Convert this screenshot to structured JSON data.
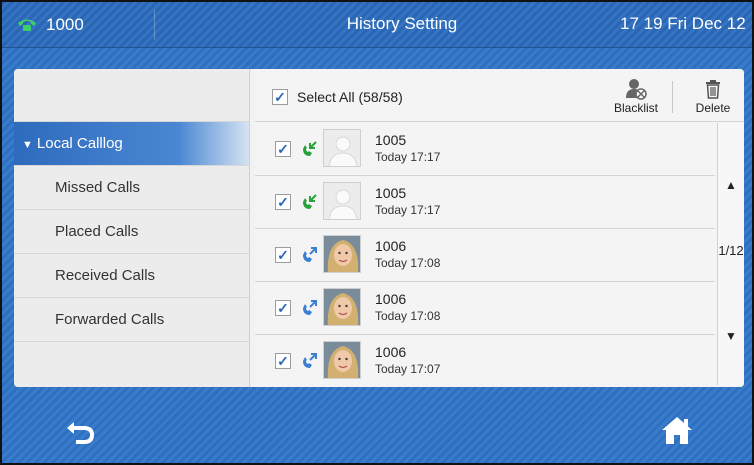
{
  "status_bar": {
    "account": "1000",
    "title": "History Setting",
    "clock": "17 19 Fri Dec 12",
    "account_icon": "phone-icon"
  },
  "sidebar": {
    "items": [
      {
        "label": "Local Calllog",
        "active": true
      },
      {
        "label": "Missed Calls"
      },
      {
        "label": "Placed Calls"
      },
      {
        "label": "Received Calls"
      },
      {
        "label": "Forwarded Calls"
      }
    ]
  },
  "toolbar": {
    "select_all_label": "Select All (58/58)",
    "select_all_checked": true,
    "blacklist_label": "Blacklist",
    "delete_label": "Delete"
  },
  "calls": [
    {
      "number": "1005",
      "time": "Today 17:17",
      "type": "received",
      "avatar": "default-avatar",
      "checked": true
    },
    {
      "number": "1005",
      "time": "Today 17:17",
      "type": "received",
      "avatar": "default-avatar",
      "checked": true
    },
    {
      "number": "1006",
      "time": "Today 17:08",
      "type": "placed",
      "avatar": "photo-avatar",
      "checked": true
    },
    {
      "number": "1006",
      "time": "Today 17:08",
      "type": "placed",
      "avatar": "photo-avatar",
      "checked": true
    },
    {
      "number": "1006",
      "time": "Today 17:07",
      "type": "placed",
      "avatar": "photo-avatar",
      "checked": true
    }
  ],
  "pager": {
    "page": "1/12",
    "up_icon": "triangle-up-icon",
    "down_icon": "triangle-down-icon"
  },
  "softkeys": {
    "back_icon": "back-arrow-icon",
    "home_icon": "home-icon"
  },
  "colors": {
    "accent_blue": "#2e6bbd",
    "received_green": "#2aa13a",
    "placed_blue": "#3b7fd0"
  }
}
